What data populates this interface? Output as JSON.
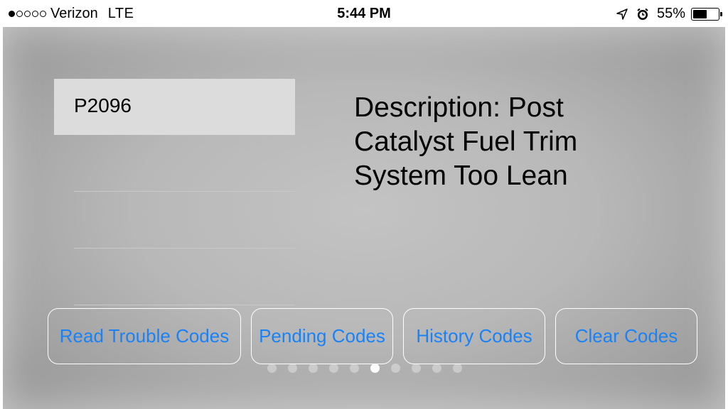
{
  "status_bar": {
    "signal_bars_filled": 1,
    "signal_bars_total": 5,
    "carrier": "Verizon",
    "network": "LTE",
    "time": "5:44 PM",
    "battery_percent": "55%",
    "battery_level": 0.55,
    "icons": [
      "location-arrow-icon",
      "alarm-clock-icon",
      "battery-icon"
    ]
  },
  "codes": {
    "selected_code": "P2096",
    "empty_rows": 3
  },
  "description": {
    "text": "Description: Post Catalyst Fuel Trim System Too Lean"
  },
  "buttons": {
    "read": "Read Trouble Codes",
    "pending": "Pending Codes",
    "history": "History Codes",
    "clear": "Clear Codes"
  },
  "pager": {
    "total_pages": 10,
    "current_page": 6
  },
  "colors": {
    "accent": "#1a82f7",
    "selected_row": "#dcdcdc"
  }
}
